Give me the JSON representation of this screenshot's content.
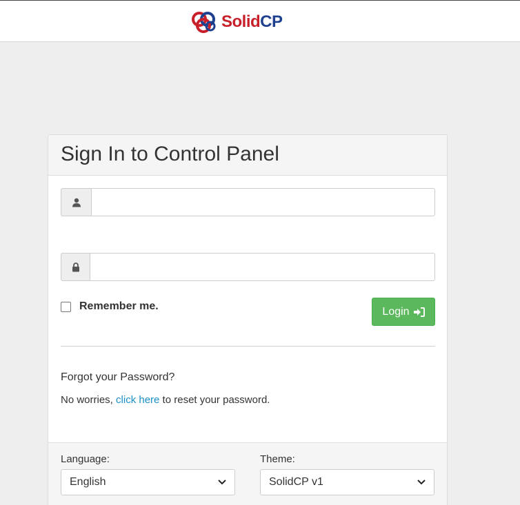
{
  "header": {
    "logo": {
      "solid": "Solid",
      "cp": "CP"
    }
  },
  "login_panel": {
    "title": "Sign In to Control Panel",
    "username": {
      "value": "",
      "icon": "user-icon"
    },
    "password": {
      "value": "",
      "icon": "lock-icon"
    },
    "remember_label": "Remember me.",
    "remember_checked": false,
    "login_button": {
      "label": "Login",
      "icon": "sign-in-icon"
    },
    "forgot": {
      "title": "Forgot your Password?",
      "text_before": "No worries, ",
      "link": "click here",
      "text_after": " to reset your password."
    }
  },
  "footer": {
    "language": {
      "label": "Language:",
      "selected": "English"
    },
    "theme": {
      "label": "Theme:",
      "selected": "SolidCP v1"
    }
  },
  "colors": {
    "login_button": "#5cb85c",
    "link": "#1a8fc9",
    "logo_red": "#c8202a",
    "logo_blue": "#1f3f8f"
  }
}
